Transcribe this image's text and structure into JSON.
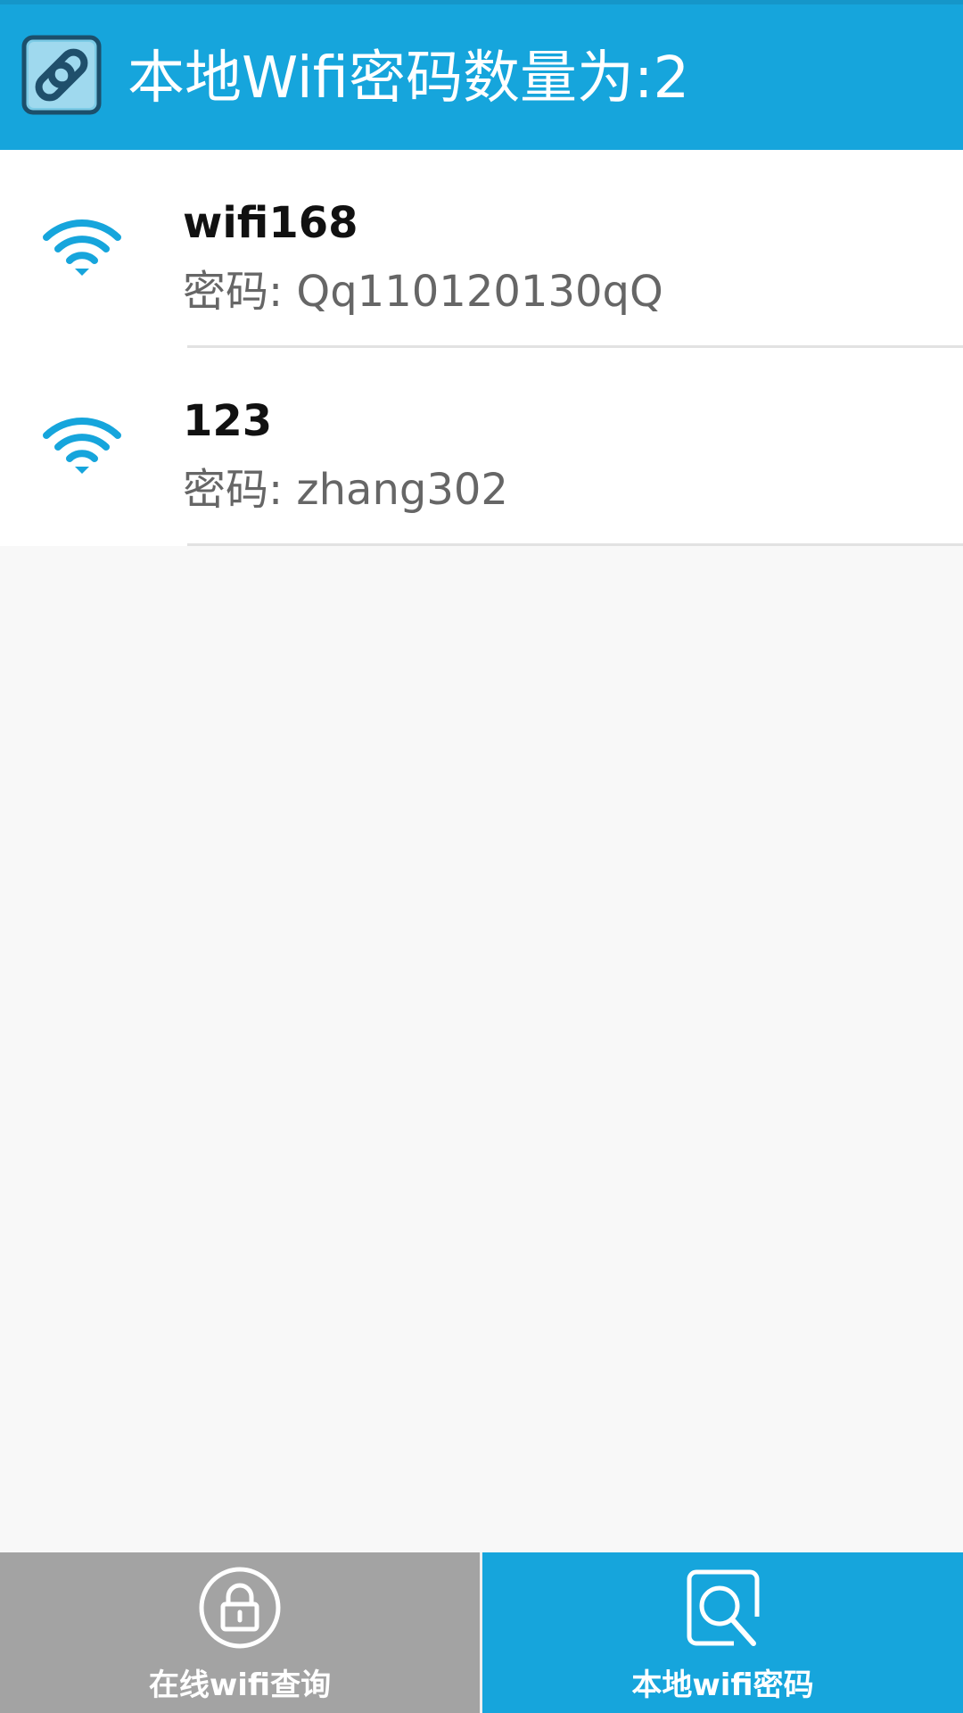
{
  "app_bar": {
    "title": "本地Wifi密码数量为:2",
    "logo_icon": "link-logo-icon",
    "background": "#16a5dc"
  },
  "wifi_list": [
    {
      "ssid": "wifi168",
      "password": "密码: Qq110120130qQ",
      "icon": "wifi-icon"
    },
    {
      "ssid": "123",
      "password": "密码: zhang302",
      "icon": "wifi-icon"
    }
  ],
  "bottom_nav": {
    "tabs": [
      {
        "label": "在线wifi查询",
        "icon": "lock-icon",
        "selected": false
      },
      {
        "label": "本地wifi密码",
        "icon": "search-icon",
        "selected": true
      }
    ]
  },
  "colors": {
    "accent": "#16a5dc",
    "inactive_tab": "#a3a3a3",
    "page_background": "#f8f8f8"
  }
}
